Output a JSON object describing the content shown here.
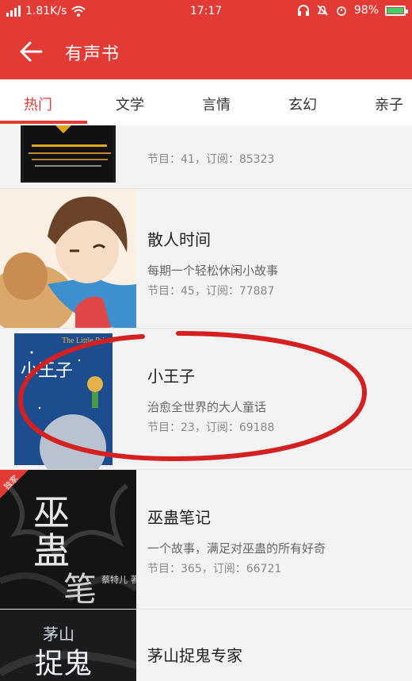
{
  "status": {
    "signal": "4G",
    "speed": "1.81K/s",
    "time": "17:17",
    "battery": "98%"
  },
  "appbar": {
    "title": "有声书",
    "back_icon": "arrow-left-icon"
  },
  "tabs": [
    {
      "label": "热门",
      "active": true
    },
    {
      "label": "文学"
    },
    {
      "label": "言情"
    },
    {
      "label": "玄幻"
    },
    {
      "label": "亲子"
    }
  ],
  "items": [
    {
      "stats": "节目：41，订阅：85323"
    },
    {
      "title": "散人时间",
      "desc": "每期一个轻松休闲小故事",
      "stats": "节目：45，订阅：77887"
    },
    {
      "title": "小王子",
      "desc": "治愈全世界的大人童话",
      "stats": "节目：23，订阅：69188",
      "cover_text": "小王子",
      "cover_sub": "The Little Prince"
    },
    {
      "title": "巫蛊笔记",
      "desc": "一个故事，满足对巫蛊的所有好奇",
      "stats": "节目：365，订阅：66721",
      "badge": "独家",
      "cover_text": "巫蛊笔记",
      "cover_author": "蔡特儿 著"
    },
    {
      "title": "茅山捉鬼专家",
      "cover_text_top": "茅山",
      "cover_text_bottom": "捉鬼"
    }
  ]
}
